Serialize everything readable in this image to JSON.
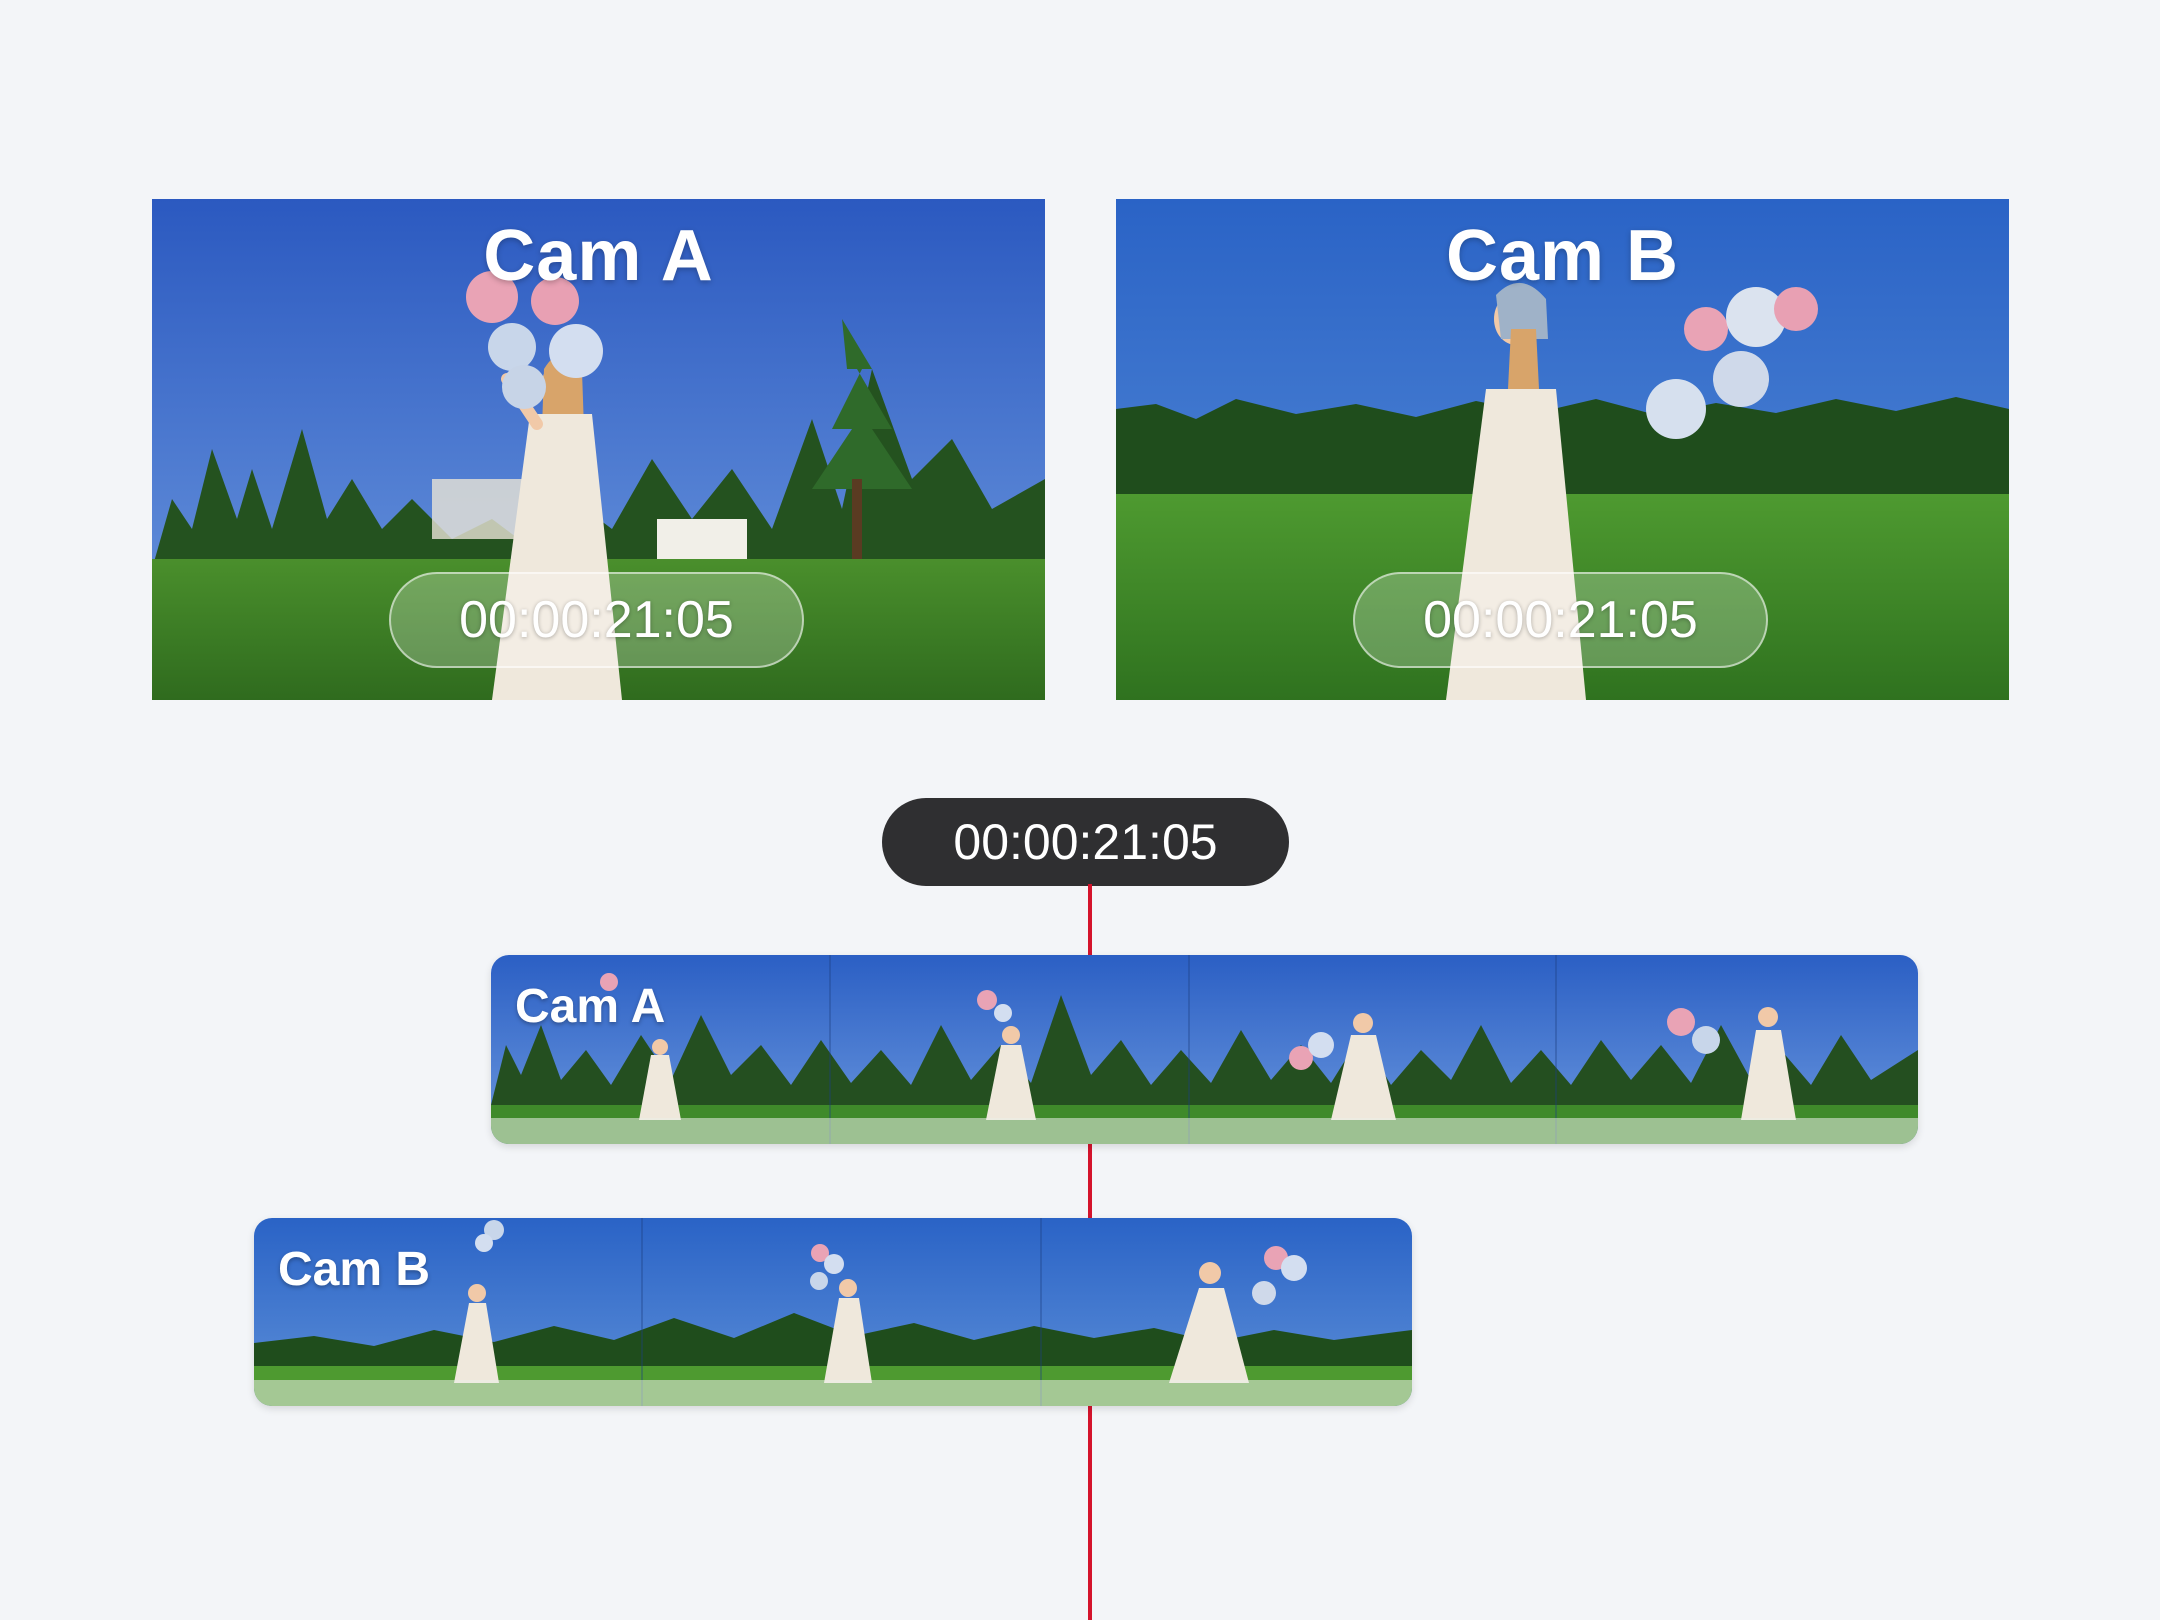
{
  "previews": {
    "cam_a": {
      "title": "Cam A",
      "timecode": "00:00:21:05"
    },
    "cam_b": {
      "title": "Cam B",
      "timecode": "00:00:21:05"
    }
  },
  "playhead": {
    "timecode": "00:00:21:05",
    "color": "#d4142c"
  },
  "timeline": {
    "tracks": [
      {
        "label": "Cam A"
      },
      {
        "label": "Cam B"
      }
    ]
  },
  "colors": {
    "background": "#f3f5f8",
    "badge": "#2f2f31",
    "sky": "#2f63c4",
    "grass": "#3f8a2a"
  }
}
